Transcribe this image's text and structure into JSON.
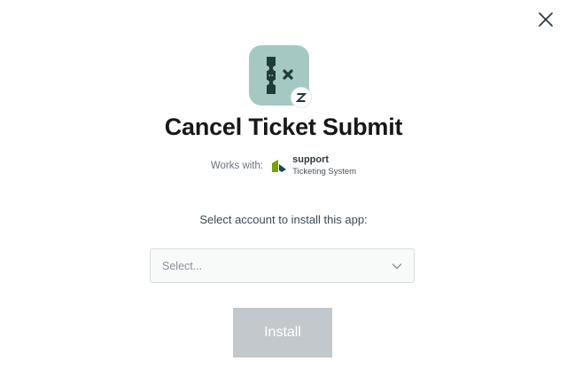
{
  "modal": {
    "close_icon": "close-icon",
    "app": {
      "icon": "ticket-cancel-icon",
      "badge_icon": "zendesk-icon",
      "title": "Cancel Ticket Submit"
    },
    "works_with": {
      "label": "Works with:",
      "product_name": "support",
      "product_subtitle": "Ticketing System",
      "product_icon": "zendesk-support-icon"
    },
    "account": {
      "prompt": "Select account to install this app:",
      "placeholder": "Select...",
      "chevron_icon": "chevron-down-icon"
    },
    "install_button": {
      "label": "Install",
      "enabled": false
    }
  },
  "colors": {
    "app_icon_bg": "#a5c8c3",
    "install_disabled_bg": "#c2c8cc",
    "title_text": "#17181a"
  }
}
